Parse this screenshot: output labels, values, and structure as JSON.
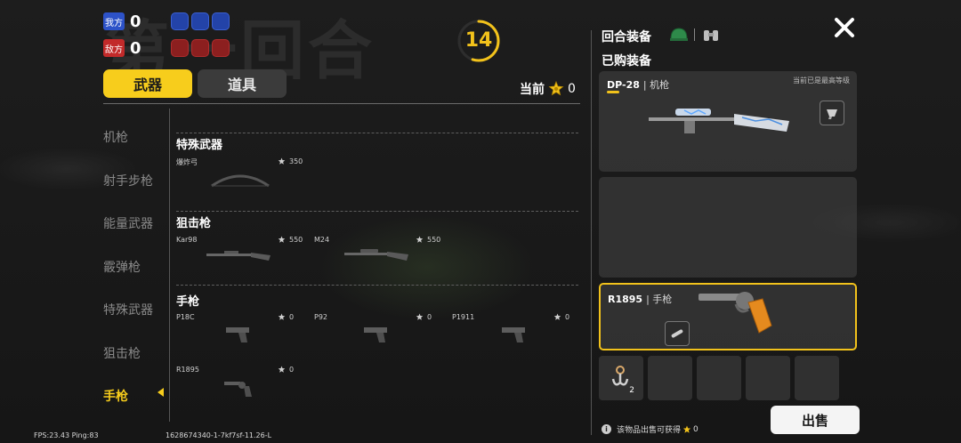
{
  "background": {
    "round_text": "第一回合"
  },
  "scoreboard": {
    "own": {
      "label": "我方",
      "score": "0"
    },
    "enemy": {
      "label": "敌方",
      "score": "0"
    }
  },
  "timer": {
    "value": "14",
    "progress": 0.55
  },
  "tabs": [
    {
      "label": "武器",
      "active": true
    },
    {
      "label": "道具",
      "active": false
    }
  ],
  "currency": {
    "label": "当前",
    "value": "0"
  },
  "categories": [
    {
      "label": "机枪"
    },
    {
      "label": "射手步枪"
    },
    {
      "label": "能量武器"
    },
    {
      "label": "霰弹枪"
    },
    {
      "label": "特殊武器"
    },
    {
      "label": "狙击枪"
    },
    {
      "label": "手枪",
      "active": true
    }
  ],
  "sections": [
    {
      "title": "特殊武器",
      "items": [
        {
          "name": "爆炸弓",
          "price": "350"
        }
      ]
    },
    {
      "title": "狙击枪",
      "items": [
        {
          "name": "Kar98",
          "price": "550"
        },
        {
          "name": "M24",
          "price": "550"
        }
      ]
    },
    {
      "title": "手枪",
      "items": [
        {
          "name": "P18C",
          "price": "0"
        },
        {
          "name": "P92",
          "price": "0"
        },
        {
          "name": "P1911",
          "price": "0"
        },
        {
          "name": "R1895",
          "price": "0"
        }
      ]
    }
  ],
  "right_panel": {
    "title": "回合装备",
    "subtitle": "已购装备",
    "primary": {
      "name": "DP-28",
      "type": "机枪",
      "note": "当前已是最高等级"
    },
    "secondary": {
      "name": "R1895",
      "type": "手枪"
    },
    "item": {
      "count": "2"
    },
    "sell_hint": "该物品出售可获得",
    "sell_value": "0",
    "sell_label": "出售"
  },
  "debug": {
    "fps": "FPS:23.43 Ping:83",
    "build": "1628674340-1-7kf7sf-11.26-L"
  },
  "colors": {
    "accent": "#f7cd1c",
    "blue_team": "#2d52c8",
    "red_team": "#c22a2a"
  }
}
